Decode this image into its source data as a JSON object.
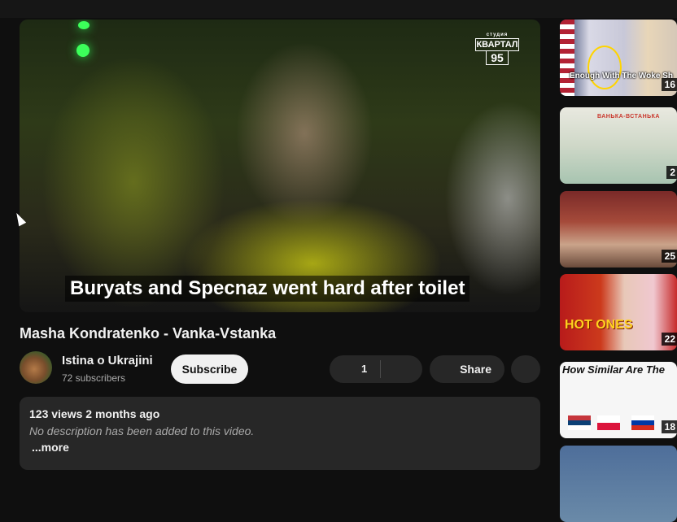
{
  "video": {
    "title": "Masha Kondratenko - Vanka-Vstanka",
    "subtitle": "Buryats and Specnaz went hard after toilet",
    "watermark": {
      "top": "студия",
      "name": "КВАРТАЛ",
      "number": "95"
    }
  },
  "channel": {
    "name": "Istina o Ukrajini",
    "subscribers": "72 subscribers",
    "subscribe_label": "Subscribe"
  },
  "actions": {
    "like_count": "1",
    "share_label": "Share"
  },
  "description": {
    "meta": "123 views  2 months ago",
    "text": "No description has been added to this video.",
    "more_label": "...more"
  },
  "sidebar": {
    "items": [
      {
        "overlay": "Enough With The Woke Sh",
        "duration": "16"
      },
      {
        "overlay": "ВАНЬКА-ВСТАНЬКА",
        "duration": "2"
      },
      {
        "overlay": "",
        "duration": "25"
      },
      {
        "overlay": "HOT ONES",
        "duration": "22"
      },
      {
        "overlay": "How Similar Are The",
        "duration": "18"
      }
    ]
  },
  "colors": {
    "background": "#0f0f0f",
    "pill": "#272727",
    "subscribe_bg": "#f1f1f1",
    "secondary_text": "#aaaaaa"
  }
}
